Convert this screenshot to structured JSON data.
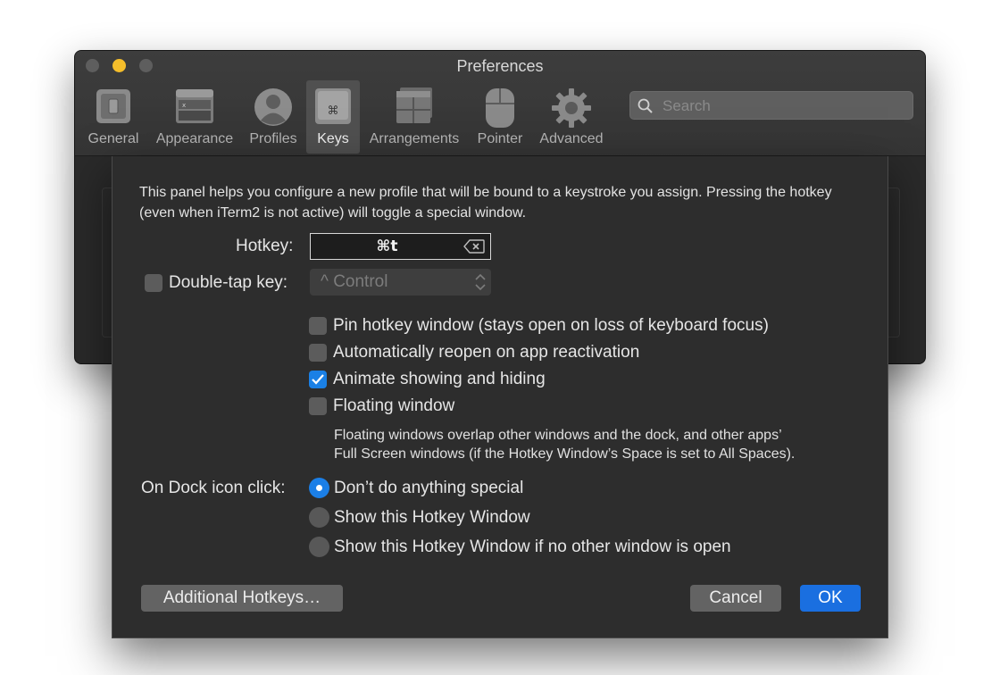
{
  "window": {
    "title": "Preferences",
    "search_placeholder": "Search"
  },
  "toolbar": {
    "items": [
      {
        "label": "General",
        "icon": "general-switch-icon"
      },
      {
        "label": "Appearance",
        "icon": "appearance-window-icon"
      },
      {
        "label": "Profiles",
        "icon": "profiles-person-icon"
      },
      {
        "label": "Keys",
        "icon": "keys-command-key-icon"
      },
      {
        "label": "Arrangements",
        "icon": "arrangements-windows-icon"
      },
      {
        "label": "Pointer",
        "icon": "pointer-mouse-icon"
      },
      {
        "label": "Advanced",
        "icon": "advanced-gear-icon"
      }
    ],
    "active": "Keys"
  },
  "sheet": {
    "intro": "This panel helps you configure a new profile that will be bound to a keystroke you assign. Pressing the hotkey (even when iTerm2 is not active) will toggle a special window.",
    "hotkey_label": "Hotkey:",
    "hotkey_value": "⌘t",
    "double_tap_label": "Double-tap key:",
    "double_tap_checked": false,
    "double_tap_select": "^ Control",
    "options": [
      {
        "label": "Pin hotkey window (stays open on loss of keyboard focus)",
        "checked": false
      },
      {
        "label": "Automatically reopen on app reactivation",
        "checked": false
      },
      {
        "label": "Animate showing and hiding",
        "checked": true
      },
      {
        "label": "Floating window",
        "checked": false
      }
    ],
    "floating_note_line1": "Floating windows overlap other windows and the dock, and other apps’",
    "floating_note_line2": "Full Screen windows (if the Hotkey Window’s Space is set to All Spaces).",
    "dock_label": "On Dock icon click:",
    "dock_options": [
      {
        "label": "Don’t do anything special",
        "selected": true
      },
      {
        "label": "Show this Hotkey Window",
        "selected": false
      },
      {
        "label": "Show this Hotkey Window if no other window is open",
        "selected": false
      }
    ],
    "additional_button": "Additional Hotkeys…",
    "cancel_button": "Cancel",
    "ok_button": "OK"
  },
  "colors": {
    "accent": "#1a80e5",
    "sheet_bg": "#2d2d2d",
    "window_bg": "#2a2a2a"
  }
}
